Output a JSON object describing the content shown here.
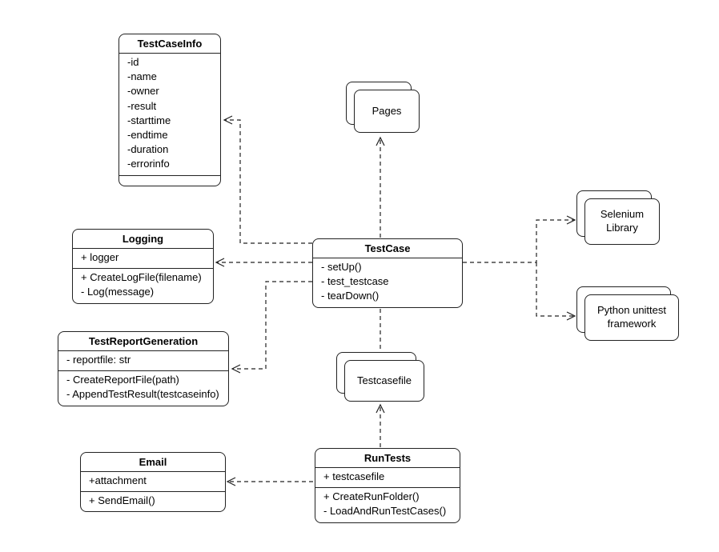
{
  "classes": {
    "testCaseInfo": {
      "name": "TestCaseInfo",
      "attrs": [
        "-id",
        "-name",
        "-owner",
        "-result",
        "-starttime",
        "-endtime",
        "-duration",
        "-errorinfo"
      ]
    },
    "logging": {
      "name": "Logging",
      "attrs": [
        "+ logger"
      ],
      "ops": [
        "+ CreateLogFile(filename)",
        "- Log(message)"
      ]
    },
    "testReportGeneration": {
      "name": "TestReportGeneration",
      "attrs": [
        "- reportfile: str"
      ],
      "ops": [
        "- CreateReportFile(path)",
        "- AppendTestResult(testcaseinfo)"
      ]
    },
    "email": {
      "name": "Email",
      "attrs": [
        "+attachment"
      ],
      "ops": [
        "+ SendEmail()"
      ]
    },
    "testCase": {
      "name": "TestCase",
      "ops": [
        "- setUp()",
        "- test_testcase",
        "- tearDown()"
      ]
    },
    "runTests": {
      "name": "RunTests",
      "attrs": [
        "+ testcasefile"
      ],
      "ops": [
        "+ CreateRunFolder()",
        "- LoadAndRunTestCases()"
      ]
    }
  },
  "packages": {
    "pages": "Pages",
    "testcasefile": "Testcasefile",
    "selenium": "Selenium\nLibrary",
    "unittest": "Python unittest\nframework"
  }
}
